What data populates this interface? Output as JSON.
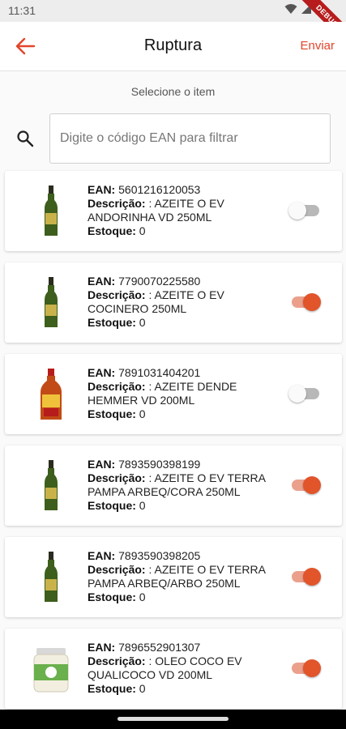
{
  "status_bar": {
    "time": "11:31"
  },
  "debug_banner": "DEBUG",
  "app_bar": {
    "title": "Ruptura",
    "action_label": "Enviar"
  },
  "subtitle": "Selecione o item",
  "search": {
    "placeholder": "Digite o código EAN para filtrar",
    "value": ""
  },
  "labels": {
    "ean": "EAN:",
    "descricao": "Descrição:",
    "estoque": "Estoque:"
  },
  "items": [
    {
      "ean": "5601216120053",
      "descricao": ": AZEITE O EV ANDORINHA VD 250ML",
      "estoque": "0",
      "selected": false,
      "thumbnail": "olive-oil-bottle"
    },
    {
      "ean": "7790070225580",
      "descricao": ": AZEITE O EV COCINERO 250ML",
      "estoque": "0",
      "selected": true,
      "thumbnail": "olive-oil-bottle"
    },
    {
      "ean": "7891031404201",
      "descricao": ": AZEITE DENDE HEMMER VD 200ML",
      "estoque": "0",
      "selected": false,
      "thumbnail": "dende-oil-bottle"
    },
    {
      "ean": "7893590398199",
      "descricao": ": AZEITE O EV TERRA PAMPA ARBEQ/CORA 250ML",
      "estoque": "0",
      "selected": true,
      "thumbnail": "olive-oil-bottle"
    },
    {
      "ean": "7893590398205",
      "descricao": ": AZEITE O EV TERRA PAMPA ARBEQ/ARBO 250ML",
      "estoque": "0",
      "selected": true,
      "thumbnail": "olive-oil-bottle"
    },
    {
      "ean": "7896552901307",
      "descricao": ": OLEO COCO EV QUALICOCO VD 200ML",
      "estoque": "0",
      "selected": true,
      "thumbnail": "coconut-oil-jar"
    }
  ],
  "colors": {
    "accent": "#e2542a",
    "accent_track": "#eba08c",
    "off_track": "#b8b8b8"
  }
}
